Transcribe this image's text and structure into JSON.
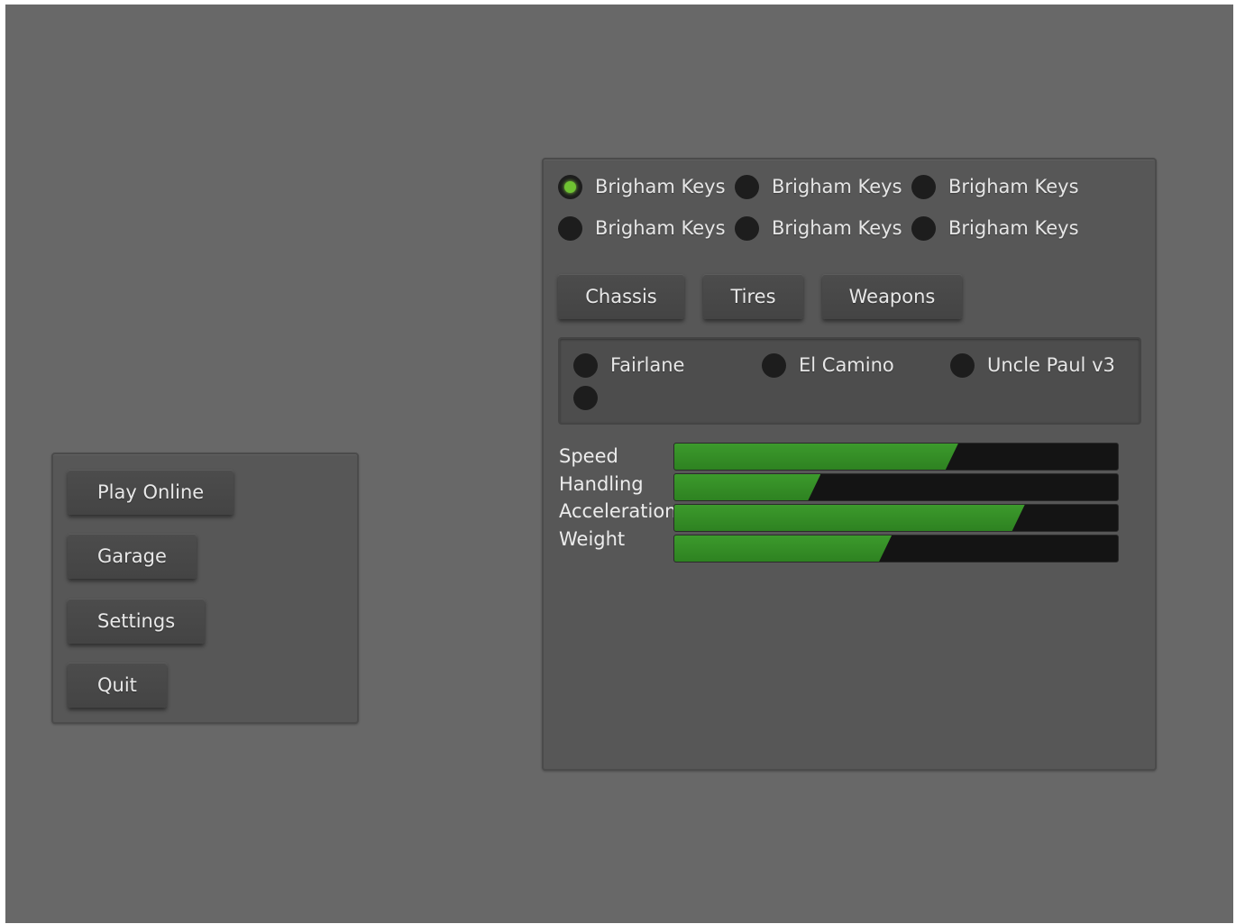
{
  "main_menu": {
    "buttons": [
      {
        "label": "Play Online"
      },
      {
        "label": "Garage"
      },
      {
        "label": "Settings"
      },
      {
        "label": "Quit"
      }
    ]
  },
  "garage": {
    "drivers": [
      {
        "label": "Brigham Keys",
        "selected": true
      },
      {
        "label": "Brigham Keys",
        "selected": false
      },
      {
        "label": "Brigham Keys",
        "selected": false
      },
      {
        "label": "Brigham Keys",
        "selected": false
      },
      {
        "label": "Brigham Keys",
        "selected": false
      },
      {
        "label": "Brigham Keys",
        "selected": false
      }
    ],
    "tabs": [
      {
        "label": "Chassis"
      },
      {
        "label": "Tires"
      },
      {
        "label": "Weapons"
      }
    ],
    "chassis_options": [
      {
        "label": "Fairlane",
        "selected": false
      },
      {
        "label": "El Camino",
        "selected": false
      },
      {
        "label": "Uncle Paul v3",
        "selected": false
      },
      {
        "label": "",
        "selected": false
      }
    ],
    "stats": [
      {
        "label": "Speed",
        "value": 0.64
      },
      {
        "label": "Handling",
        "value": 0.33
      },
      {
        "label": "Acceleration",
        "value": 0.79
      },
      {
        "label": "Weight",
        "value": 0.49
      }
    ]
  },
  "colors": {
    "background": "#686868",
    "panel": "#575757",
    "accent_green": "#3c9a2c",
    "radio_checked": "#6fc232"
  }
}
